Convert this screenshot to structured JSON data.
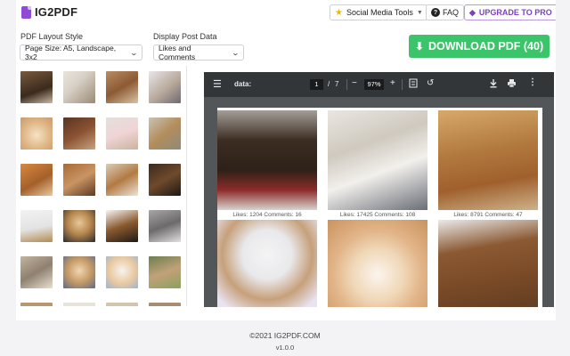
{
  "header": {
    "logo_text": "IG2PDF",
    "social_tools_label": "Social Media Tools",
    "faq_label": "FAQ",
    "upgrade_label": "UPGRADE TO PRO"
  },
  "controls": {
    "layout_label": "PDF Layout Style",
    "layout_value": "Page Size: A5, Landscape, 3x2",
    "post_data_label": "Display Post Data",
    "post_data_value": "Likes and Comments",
    "download_label": "DOWNLOAD PDF (40)"
  },
  "viewer": {
    "doc_title": "data:",
    "current_page": "1",
    "page_sep": "/",
    "total_pages": "7",
    "zoom": "97%",
    "minus": "−",
    "plus": "+"
  },
  "pdf_captions": [
    "Likes: 1204  Comments: 16",
    "Likes: 17425  Comments: 108",
    "Likes: 8791  Comments: 47"
  ],
  "footer": {
    "copyright": "©2021 IG2PDF.COM",
    "version": "v1.0.0"
  },
  "colors": {
    "accent": "#3cc46a",
    "brand": "#8d4bd6",
    "viewer_toolbar": "#323639",
    "viewer_bg": "#525659"
  }
}
